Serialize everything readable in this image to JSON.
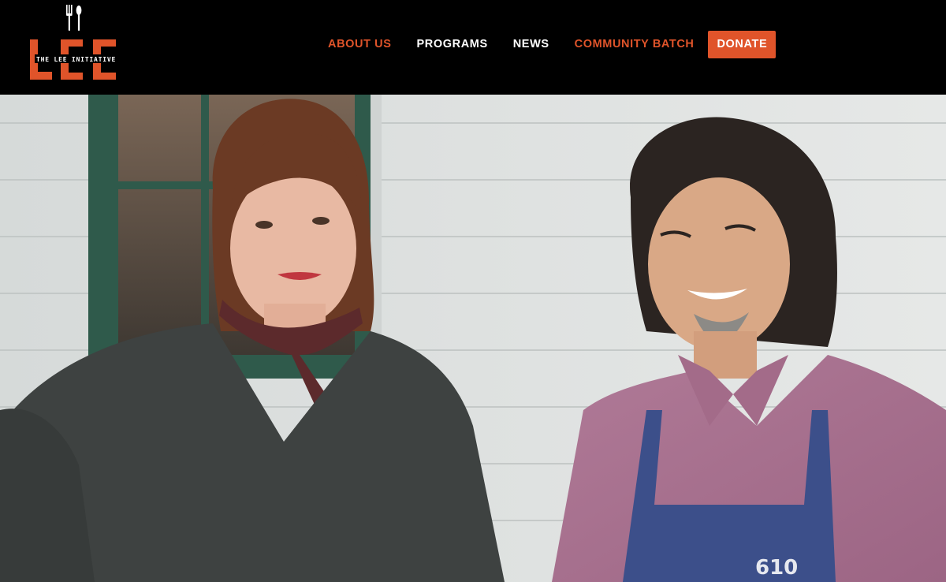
{
  "logo": {
    "wordmark": "LEE",
    "tagline": "THE LEE INITIATIVE",
    "icon": "fork-and-spoon-icon"
  },
  "nav": {
    "items": [
      {
        "label": "ABOUT US",
        "color": "#e0542a"
      },
      {
        "label": "PROGRAMS",
        "color": "#ffffff"
      },
      {
        "label": "NEWS",
        "color": "#ffffff"
      },
      {
        "label": "COMMUNITY BATCH",
        "color": "#e0542a"
      }
    ],
    "donate_label": "DONATE"
  },
  "hero": {
    "apron_text": "610"
  },
  "colors": {
    "brand_orange": "#e0542a",
    "header_bg": "#000000"
  }
}
